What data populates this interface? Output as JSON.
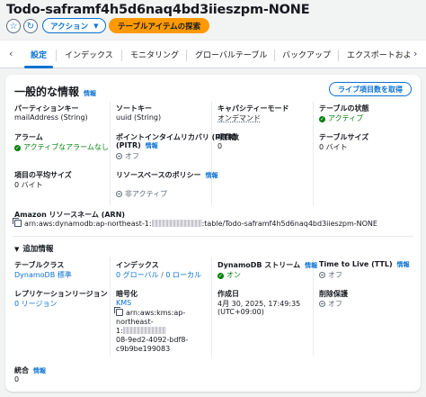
{
  "page": {
    "title": "Todo-saframf4h5d6naq4bd3iieszpm-NONE",
    "actions_label": "アクション",
    "explore_label": "テーブルアイテムの探索"
  },
  "tabs": [
    "設定",
    "インデックス",
    "モニタリング",
    "グローバルテーブル",
    "バックアップ",
    "エクスポートおよ"
  ],
  "general": {
    "heading": "一般的な情報",
    "info": "情報",
    "live_button": "ライブ項目数を取得",
    "partition_key_label": "パーティションキー",
    "partition_key_value": "mailAddress (String)",
    "sort_key_label": "ソートキー",
    "sort_key_value": "uuid (String)",
    "capacity_label": "キャパシティーモード",
    "capacity_value": "オンデマンド",
    "table_status_label": "テーブルの状態",
    "table_status_value": "アクティブ",
    "alarm_label": "アラーム",
    "alarm_value": "アクティブなアラームなし",
    "pitr_label": "ポイントインタイムリカバリ (PITR)",
    "pitr_info": "情報",
    "pitr_value": "オフ",
    "item_count_label": "項目数",
    "item_count_value": "0",
    "table_size_label": "テーブルサイズ",
    "table_size_value": "0 バイト",
    "avg_item_size_label": "項目の平均サイズ",
    "avg_item_size_value": "0 バイト",
    "resource_policy_label": "リソースベースのポリシー",
    "resource_policy_info": "情報",
    "resource_policy_value": "非アクティブ",
    "arn_label": "Amazon リソースネーム (ARN)",
    "arn_prefix": "arn:aws:dynamodb:ap-northeast-1:",
    "arn_suffix": ":table/Todo-saframf4h5d6naq4bd3iieszpm-NONE"
  },
  "additional": {
    "heading": "追加情報",
    "table_class_label": "テーブルクラス",
    "table_class_value": "DynamoDB 標準",
    "indexes_label": "インデックス",
    "indexes_global": "0 グローバル",
    "indexes_local": "0 ローカル",
    "stream_label": "DynamoDB ストリーム",
    "stream_info": "情報",
    "stream_value": "オン",
    "ttl_label": "Time to Live (TTL)",
    "ttl_info": "情報",
    "ttl_value": "オフ",
    "replication_label": "レプリケーションリージョン",
    "replication_value": "0 リージョン",
    "encryption_label": "暗号化",
    "encryption_value": "KMS",
    "kms_line1": "arn:aws:kms:ap-",
    "kms_line2": "northeast-",
    "kms_line3": "1:",
    "kms_line4": "08-9ed2-4092-bdf8-",
    "kms_line5": "c9b9be199083",
    "created_label": "作成日",
    "created_line1": "4月 30, 2025, 17:49:35",
    "created_line2": "(UTC+09:00)",
    "deletion_label": "削除保護",
    "deletion_value": "オフ",
    "integration_label": "統合",
    "integration_info": "情報",
    "integration_value": "0"
  }
}
